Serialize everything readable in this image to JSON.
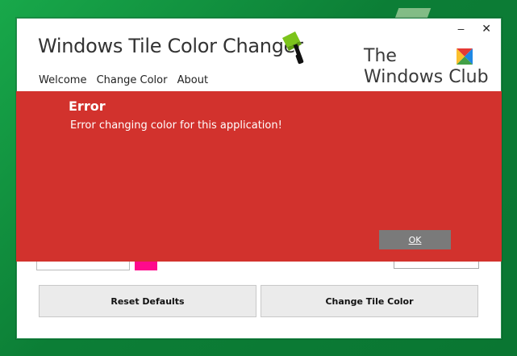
{
  "window": {
    "title": "Windows Tile Color Changer",
    "minimize_glyph": "–",
    "close_glyph": "✕"
  },
  "logo": {
    "line1": "The",
    "line2": "Windows Club"
  },
  "nav": {
    "items": [
      {
        "label": "Welcome"
      },
      {
        "label": "Change Color"
      },
      {
        "label": "About"
      }
    ]
  },
  "error": {
    "title": "Error",
    "message": "Error changing color for this application!",
    "ok_label": "OK"
  },
  "buttons": {
    "reset_label": "Reset Defaults",
    "change_label": "Change Tile Color"
  },
  "colors": {
    "error_bg": "#d2322d",
    "swatch": "#ff0a8c",
    "desktop": "#0f8a3c"
  },
  "icons": [
    "paint-roller-icon",
    "windows-club-logo-icon",
    "minimize-icon",
    "close-icon"
  ]
}
